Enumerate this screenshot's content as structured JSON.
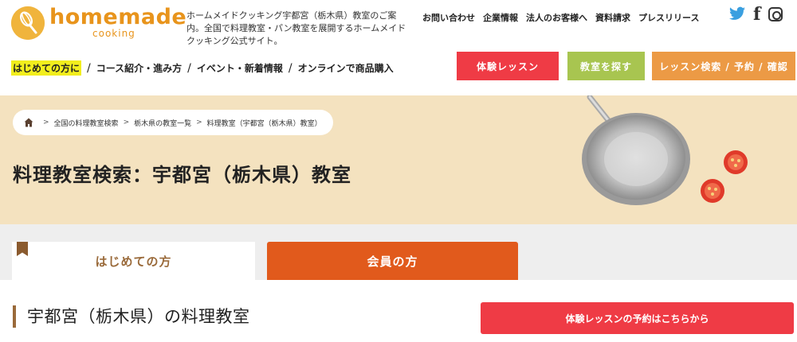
{
  "header": {
    "logo_text": "homemade",
    "logo_sub": "cooking",
    "tagline": "ホームメイドクッキング宇都宮（栃木県）教室のご案内。全国で料理教室・パン教室を展開するホームメイドクッキング公式サイト。",
    "utility_links": [
      "お問い合わせ",
      "企業情報",
      "法人のお客様へ",
      "資料請求",
      "プレスリリース"
    ],
    "social": [
      "twitter-icon",
      "facebook-icon",
      "instagram-icon"
    ],
    "nav": {
      "first": "はじめての方に",
      "items": [
        "コース紹介・進み方",
        "イベント・新着情報",
        "オンラインで商品購入"
      ],
      "separator": "/"
    },
    "buttons": {
      "trial": "体験レッスン",
      "find": "教室を探す",
      "search": "レッスン検索 / 予約 / 確認"
    },
    "colors": {
      "trial": "#ef3b45",
      "find": "#a8c550",
      "search": "#ec9a45",
      "logo": "#e8941c"
    }
  },
  "hero": {
    "breadcrumb": [
      "全国の料理教室検索",
      "栃木県の教室一覧",
      "料理教室（宇都宮（栃木県）教室）"
    ],
    "breadcrumb_sep": ">",
    "title": "料理教室検索：宇都宮（栃木県）教室"
  },
  "tabs": {
    "first": "はじめての方",
    "member": "会員の方"
  },
  "main": {
    "section_title": "宇都宮（栃木県）の料理教室",
    "reserve_button": "体験レッスンの予約はこちらから"
  }
}
